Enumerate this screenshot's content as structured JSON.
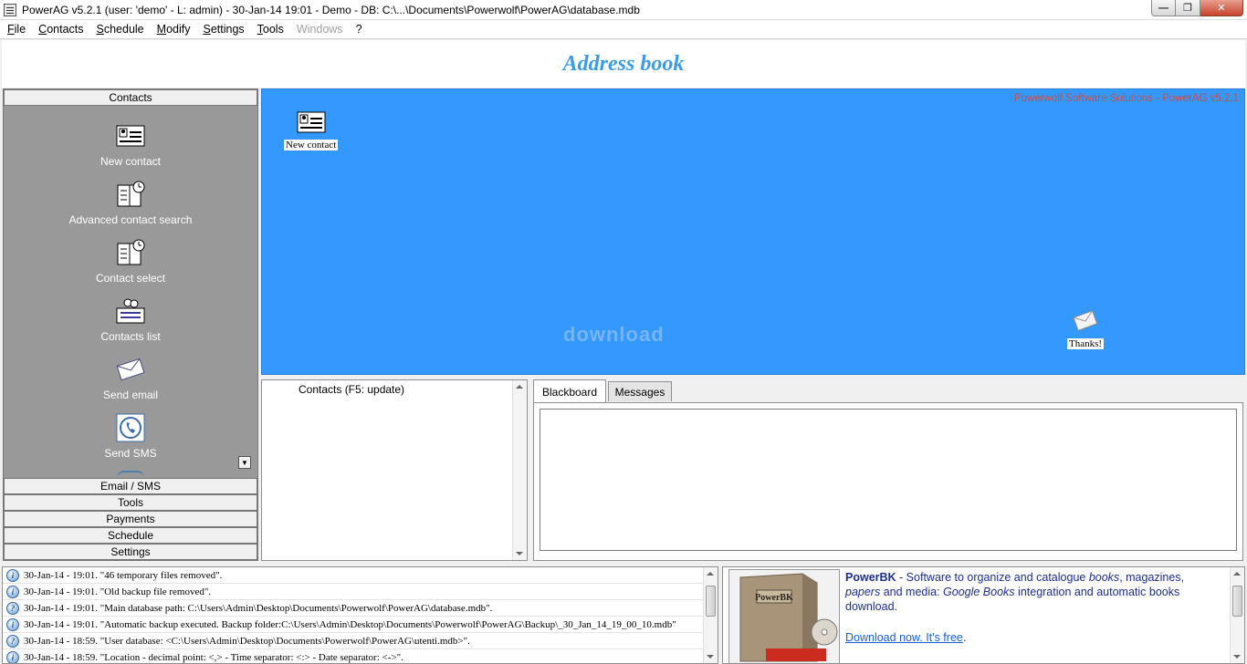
{
  "window": {
    "title": "PowerAG v5.2.1  (user: 'demo'  - L: admin) - 30-Jan-14 19:01 - Demo - DB: C:\\...\\Documents\\Powerwolf\\PowerAG\\database.mdb",
    "minimize": "0",
    "maximize": "1",
    "close": "r"
  },
  "menu": {
    "items": [
      {
        "u": "F",
        "rest": "ile"
      },
      {
        "u": "C",
        "rest": "ontacts"
      },
      {
        "u": "S",
        "rest": "chedule"
      },
      {
        "u": "M",
        "rest": "odify"
      },
      {
        "u": "S",
        "rest": "ettings"
      },
      {
        "u": "T",
        "rest": "ools"
      }
    ],
    "windows": "Windows",
    "help": "?"
  },
  "header": {
    "title": "Address book"
  },
  "sidebar": {
    "header": "Contacts",
    "items": [
      {
        "label": "New contact",
        "icon": "contact-card-icon"
      },
      {
        "label": "Advanced contact search",
        "icon": "contact-search-icon"
      },
      {
        "label": "Contact select",
        "icon": "contact-select-icon"
      },
      {
        "label": "Contacts list",
        "icon": "contacts-list-icon"
      },
      {
        "label": "Send email",
        "icon": "envelope-icon"
      },
      {
        "label": "Send SMS",
        "icon": "phone-icon"
      }
    ],
    "sections": [
      "Email / SMS",
      "Tools",
      "Payments",
      "Schedule",
      "Settings"
    ]
  },
  "desktop": {
    "brand": "Powerwolf Software Solutions - PowerAG v5.2.1",
    "new_contact": "New contact",
    "thanks": "Thanks!",
    "watermark": "download"
  },
  "contacts_panel": {
    "label": "Contacts  (F5: update)"
  },
  "tabs": {
    "blackboard": "Blackboard",
    "messages": "Messages"
  },
  "log": [
    "30-Jan-14 - 19:01. \"46 temporary files removed\".",
    "30-Jan-14 - 19:01. \"Old backup file removed\".",
    "30-Jan-14 - 19:01. \"Main database path: C:\\Users\\Admin\\Desktop\\Documents\\Powerwolf\\PowerAG\\database.mdb\".",
    "30-Jan-14 - 19:01. \"Automatic backup executed. Backup folder:C:\\Users\\Admin\\Desktop\\Documents\\Powerwolf\\PowerAG\\Backup\\_30_Jan_14_19_00_10.mdb\"",
    "30-Jan-14 - 18:59. \"User database: <C:\\Users\\Admin\\Desktop\\Documents\\Powerwolf\\PowerAG\\utenti.mdb>\".",
    "30-Jan-14 - 18:59. \"Location - decimal point: <,> - Time separator: <:> - Date separator: <->\"."
  ],
  "ad": {
    "product": "PowerBK",
    "text1": " - Software to organize and catalogue ",
    "em1": "books",
    "text2": ",  magazines, ",
    "em2": "papers",
    "text3": " and media: ",
    "em3": "Google Books",
    "text4": " integration and automatic books download.",
    "link": "Download now. It's free",
    "link_suffix": ".",
    "box_title": "PowerBK"
  }
}
